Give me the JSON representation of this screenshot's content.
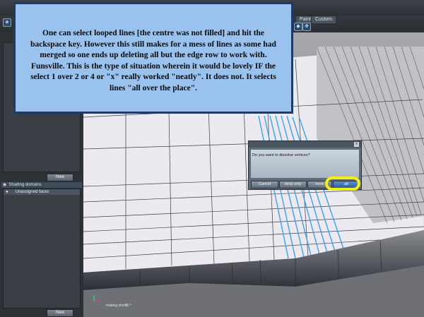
{
  "toolbar": {
    "tabs": [
      "Paint",
      "Custom"
    ]
  },
  "left_panel": {
    "new_button_top": "New",
    "shading_header": "Shading domains",
    "shading_item": "Unassigned faces",
    "new_button_bottom": "New"
  },
  "viewport": {
    "status_label": "making shellfill *"
  },
  "annotation": {
    "text": "One can select looped lines [the centre was not filled] and hit the backspace key. However this still makes for a mess of lines as some had merged so one ends up deleting all but the edge row to work with. Funsville. This is the type of situation wherein it would be lovely IF the select 1 over 2 or 4 or \"x\" really worked \"neatly\". It does not. It selects lines \"all over the place\"."
  },
  "dialog": {
    "close": "x",
    "message": "Do you want to dissolve vertices?",
    "buttons": [
      "Cancel",
      "stray only",
      "none",
      "all"
    ]
  },
  "colors": {
    "annotation_bg": "#99c2ee",
    "highlight": "#f3ef16",
    "selected_lines": "#3aa2ea"
  }
}
